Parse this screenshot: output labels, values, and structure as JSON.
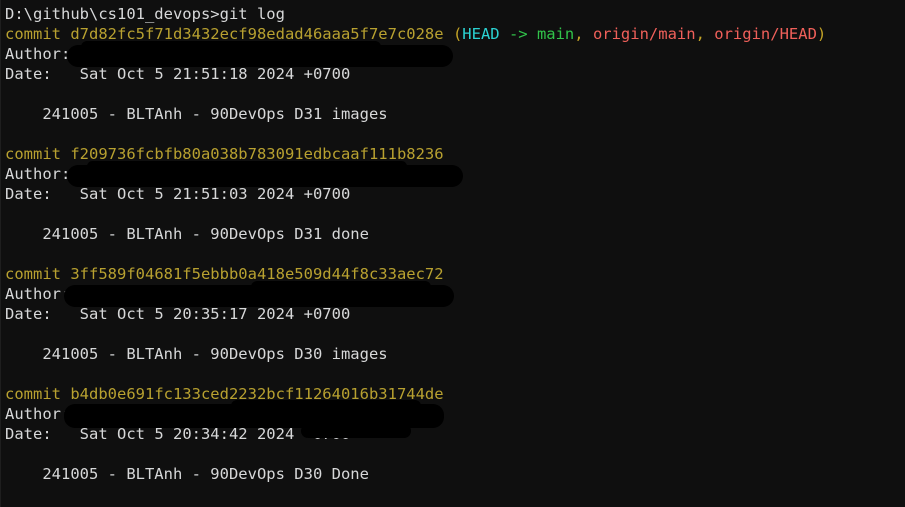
{
  "terminal": {
    "background_color": "#0f0f0f",
    "foreground_color": "#d7d8d9",
    "command_line": {
      "prompt": "D:\\github\\cs101_devops>",
      "command": "git log"
    },
    "colors": {
      "hash": "#b8a130",
      "head": "#2bd3d3",
      "local_branch": "#31c34a",
      "remote_branch": "#f0605a",
      "decoration_punctuation": "#c3a326",
      "text": "#d7d8d9"
    },
    "commits": [
      {
        "commit_label": "commit ",
        "hash": "d7d82fc5f71d3432ecf98edad46aaa5f7e7c028e",
        "decorations": {
          "open_paren": " (",
          "head": "HEAD",
          "arrow": " -> ",
          "branch": "main",
          "sep1": ", ",
          "remote_main": "origin/main",
          "sep2": ", ",
          "remote_head": "origin/HEAD",
          "close_paren": ")"
        },
        "author_label": "Author:",
        "author_value": "",
        "date_label": "Date:",
        "date_value": "   Sat Oct 5 21:51:18 2024 +0700",
        "message": "    241005 - BLTAnh - 90DevOps D31 images"
      },
      {
        "commit_label": "commit ",
        "hash": "f209736fcbfb80a038b783091edbcaaf111b8236",
        "decorations": null,
        "author_label": "Author:",
        "author_value": "",
        "date_label": "Date:",
        "date_value": "   Sat Oct 5 21:51:03 2024 +0700",
        "message": "    241005 - BLTAnh - 90DevOps D31 done"
      },
      {
        "commit_label": "commit ",
        "hash": "3ff589f04681f5ebbb0a418e509d44f8c33aec72",
        "decorations": null,
        "author_label": "Author:",
        "author_value": "",
        "date_label": "Date:",
        "date_value": "   Sat Oct 5 20:35:17 2024 +0700",
        "message": "    241005 - BLTAnh - 90DevOps D30 images"
      },
      {
        "commit_label": "commit ",
        "hash": "b4db0e691fc133ced2232bcf11264016b31744de",
        "decorations": null,
        "author_label": "Author:",
        "author_value": "",
        "date_label": "Date:",
        "date_value": "   Sat Oct 5 20:34:42 2024 +0700",
        "message": "    241005 - BLTAnh - 90DevOps D30 Done"
      }
    ]
  }
}
